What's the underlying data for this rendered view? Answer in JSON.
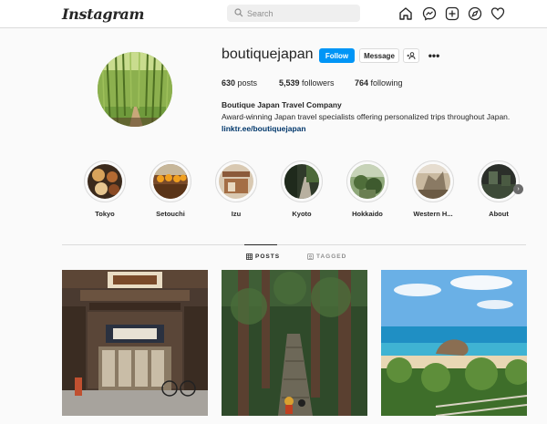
{
  "topbar": {
    "logo": "Instagram",
    "search_placeholder": "Search",
    "icons": [
      "home-icon",
      "messenger-icon",
      "new-post-icon",
      "explore-icon",
      "activity-heart-icon",
      "profile-avatar-icon"
    ]
  },
  "profile": {
    "username": "boutiquejapan",
    "follow_label": "Follow",
    "message_label": "Message",
    "stats": {
      "posts_count": "630",
      "posts_label": "posts",
      "followers_count": "5,539",
      "followers_label": "followers",
      "following_count": "764",
      "following_label": "following"
    },
    "bio_name": "Boutique Japan Travel Company",
    "bio_text": "Award-winning Japan travel specialists offering personalized trips throughout Japan.",
    "bio_link": "linktr.ee/boutiquejapan"
  },
  "highlights": [
    {
      "label": "Tokyo"
    },
    {
      "label": "Setouchi"
    },
    {
      "label": "Izu"
    },
    {
      "label": "Kyoto"
    },
    {
      "label": "Hokkaido"
    },
    {
      "label": "Western H..."
    },
    {
      "label": "About"
    }
  ],
  "tabs": {
    "posts_label": "POSTS",
    "tagged_label": "TAGGED"
  },
  "colors": {
    "accent": "#0095f6",
    "link": "#00376b",
    "text": "#262626",
    "background": "#fafafa"
  }
}
